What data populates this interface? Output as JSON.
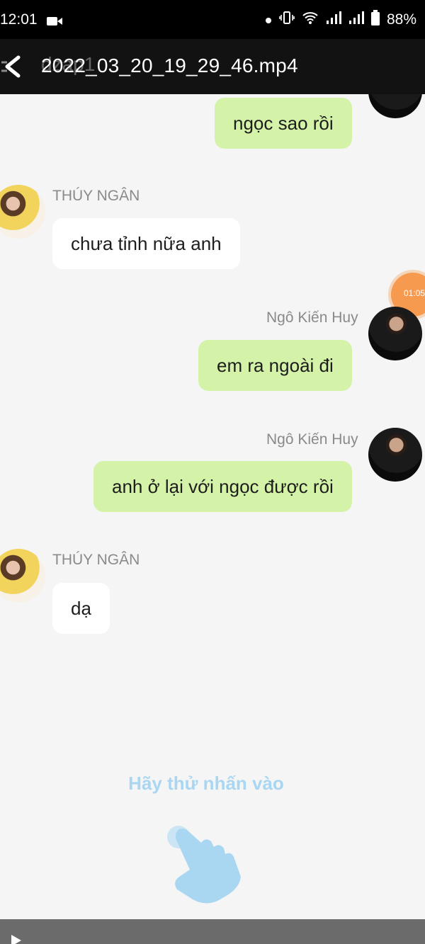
{
  "status_bar": {
    "time": "12:01",
    "battery": "88%"
  },
  "top_bar": {
    "watermark": "dzap1",
    "title": "2022_03_20_19_29_46.mp4"
  },
  "messages": [
    {
      "sender": "",
      "text": "ngọc sao rồi"
    },
    {
      "sender": "THÚY NGÂN",
      "text": "chưa tỉnh nữa anh"
    },
    {
      "sender": "Ngô Kiến Huy",
      "text": "em ra ngoài đi"
    },
    {
      "sender": "Ngô Kiến Huy",
      "text": "anh ở lại với ngọc được rồi"
    },
    {
      "sender": "THÚY NGÂN",
      "text": "dạ"
    }
  ],
  "time_badge": "01:05",
  "hint": "Hãy thử nhấn vào",
  "colors": {
    "my_bubble": "#d4f3a8",
    "their_bubble": "#ffffff",
    "hint": "#a9d7f2",
    "badge": "#f59a4e"
  }
}
